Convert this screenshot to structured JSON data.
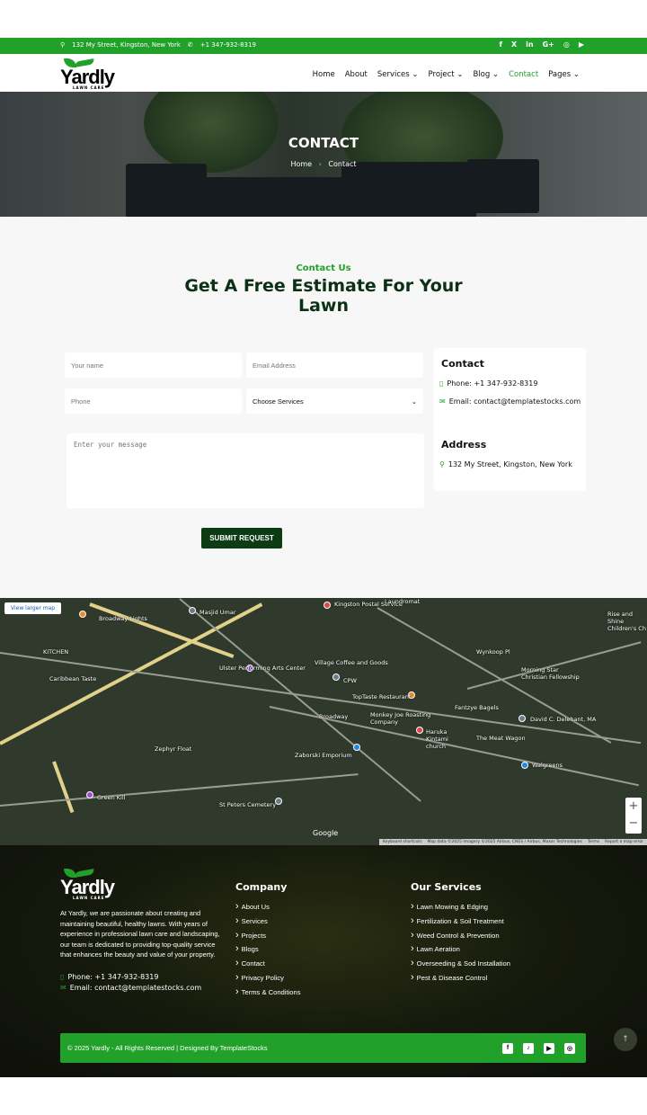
{
  "topbar": {
    "address": "132 My Street, Kingston, New York",
    "phone": "+1 347-932-8319",
    "social": [
      "f",
      "X",
      "in",
      "G+",
      "◎",
      "▶"
    ]
  },
  "brand": {
    "name": "Yardly",
    "tagline": "LAWN CARE",
    "color": "#22a12a"
  },
  "nav": {
    "items": [
      {
        "label": "Home"
      },
      {
        "label": "About"
      },
      {
        "label": "Services ⌄"
      },
      {
        "label": "Project ⌄"
      },
      {
        "label": "Blog ⌄"
      },
      {
        "label": "Contact",
        "active": true
      },
      {
        "label": "Pages ⌄"
      }
    ]
  },
  "hero": {
    "title": "CONTACT",
    "breadcrumb": [
      "Home",
      "Contact"
    ]
  },
  "contact": {
    "kicker": "Contact Us",
    "heading": "Get A Free Estimate For Your Lawn",
    "form": {
      "name_placeholder": "Your name",
      "email_placeholder": "Email Address",
      "phone_placeholder": "Phone",
      "service_selected": "Choose Services",
      "message_placeholder": "Enter your message",
      "submit": "SUBMIT REQUEST"
    },
    "card": {
      "contact_title": "Contact",
      "phone": "Phone: +1 347-932-8319",
      "email": "Email: contact@templatestocks.com",
      "address_title": "Address",
      "address": "132 My Street, Kingston, New York"
    }
  },
  "map": {
    "view_larger": "View larger map",
    "labels": [
      "Broadway Lights",
      "Masjid Umar",
      "Kingston Postal Service",
      "Laundromat",
      "KITCHEN",
      "Caribbean Taste",
      "Ulster Performing Arts Center",
      "Village Coffee and Goods",
      "CPW",
      "Wynkoop Pl",
      "Morning Star Christian Fellowship",
      "TopTaste Restaurant",
      "Monkey Joe Roasting Company",
      "Fantzye Bagels",
      "Haruka Kintami church",
      "The Meat Wagon",
      "David C. Delehant, MA",
      "Zephyr Float",
      "Zaborski Emporium",
      "Walgreens",
      "Green Kill",
      "St Peters Cemetery",
      "Rise and Shine Children's Ch",
      "Broadway",
      "Google"
    ],
    "attribution": [
      "Keyboard shortcuts",
      "Map data ©2025 Imagery ©2025 Airbus, CNES / Airbus, Maxar Technologies",
      "Terms",
      "Report a map error"
    ],
    "zoom_in": "+",
    "zoom_out": "−"
  },
  "footer": {
    "about": "At Yardly, we are passionate about creating and maintaining beautiful, healthy lawns. With years of experience in professional lawn care and landscaping, our team is dedicated to providing top-quality service that enhances the beauty and value of your property.",
    "phone": "Phone: +1 347-932-8319",
    "email": "Email: contact@templatestocks.com",
    "company_title": "Company",
    "company": [
      "About Us",
      "Services",
      "Projects",
      "Blogs",
      "Contact",
      "Privacy Policy",
      "Terms & Conditions"
    ],
    "services_title": "Our Services",
    "services": [
      "Lawn Mowing & Edging",
      "Fertilization & Soil Treatment",
      "Weed Control & Prevention",
      "Lawn Aeration",
      "Overseeding & Sod Installation",
      "Pest & Disease Control"
    ],
    "copyright": "© 2025 Yardly - All Rights Reserved | Designed By TemplateStocks",
    "social": [
      "f",
      "♪",
      "▶",
      "◎"
    ],
    "to_top": "↑"
  }
}
